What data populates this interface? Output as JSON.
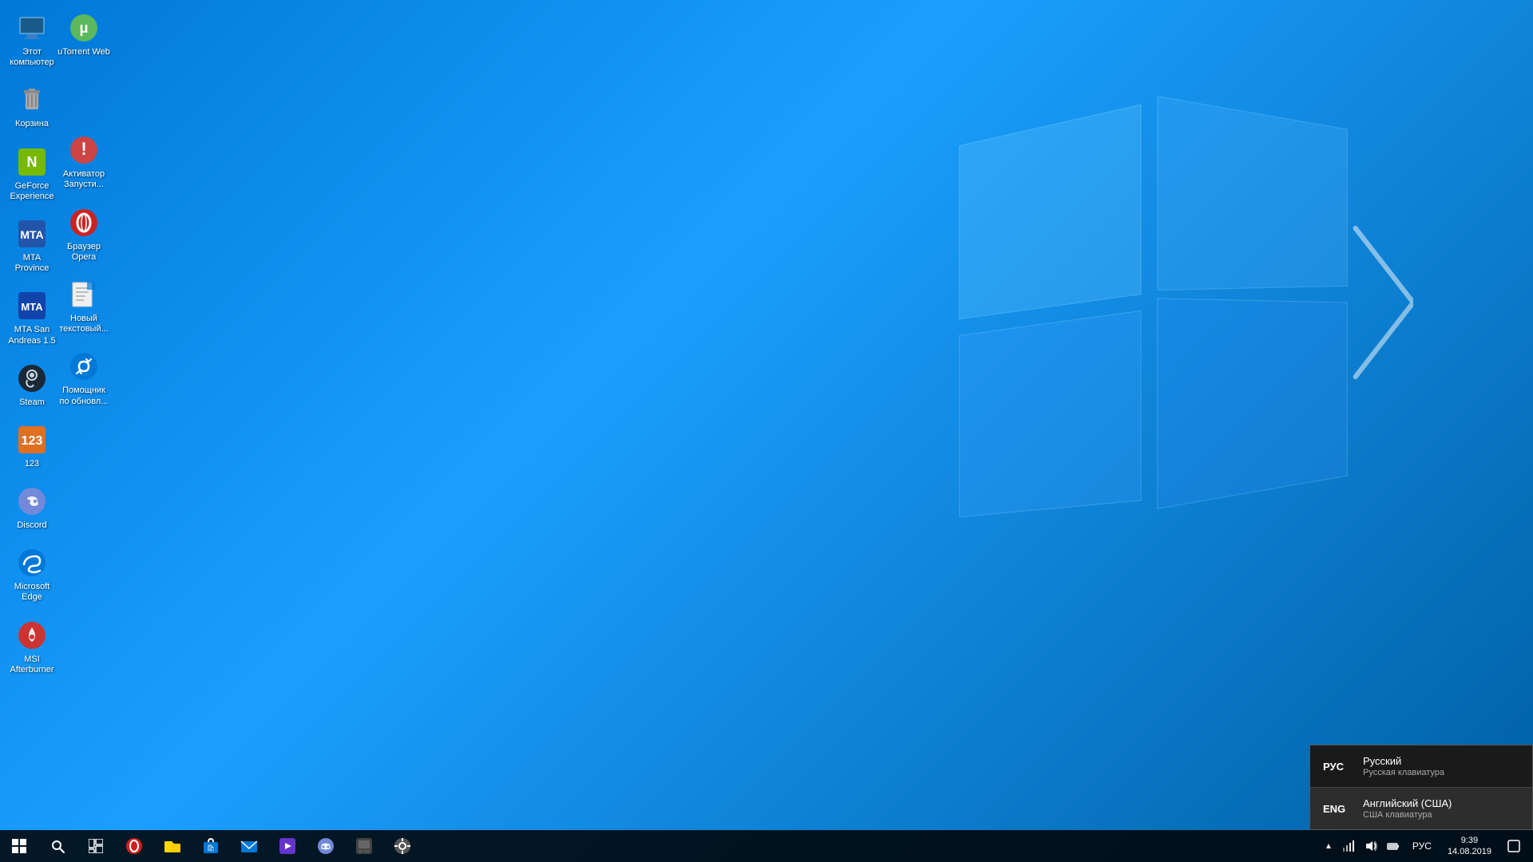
{
  "desktop": {
    "background_color_start": "#0078d7",
    "background_color_end": "#005fa3"
  },
  "icons_left": [
    {
      "id": "this-pc",
      "label": "Этот\nкомпьютер",
      "type": "pc"
    },
    {
      "id": "trash",
      "label": "Корзина",
      "type": "trash"
    },
    {
      "id": "geforce",
      "label": "GeForce\nExperience",
      "type": "geforce"
    },
    {
      "id": "mta-province",
      "label": "MTA\nProvince",
      "type": "mta"
    },
    {
      "id": "mta-san-andreas",
      "label": "MTA San\nAndreas 1.5",
      "type": "mtasa"
    },
    {
      "id": "steam",
      "label": "Steam",
      "type": "steam"
    },
    {
      "id": "123",
      "label": "123",
      "type": "123"
    },
    {
      "id": "discord",
      "label": "Discord",
      "type": "discord"
    },
    {
      "id": "microsoft-edge",
      "label": "Microsoft\nEdge",
      "type": "edge"
    },
    {
      "id": "msi-afterburner",
      "label": "MSI\nAfterburner",
      "type": "msi"
    }
  ],
  "icons_right": [
    {
      "id": "utorrent",
      "label": "uTorrent Web",
      "type": "utorrent"
    },
    {
      "id": "blank1",
      "label": "",
      "type": "blank"
    },
    {
      "id": "activator",
      "label": "Активатор\nЗапусти...",
      "type": "activator"
    },
    {
      "id": "opera",
      "label": "Браузер\nOpera",
      "type": "opera"
    },
    {
      "id": "notepad",
      "label": "Новый\nтекстовый...",
      "type": "notepad"
    },
    {
      "id": "updater",
      "label": "Помощник\nпо обновл...",
      "type": "updater"
    }
  ],
  "language_popup": {
    "items": [
      {
        "code": "РУС",
        "name": "Русский",
        "keyboard": "Русская клавиатура",
        "active": true
      },
      {
        "code": "ENG",
        "name": "Английский (США)",
        "keyboard": "США клавиатура",
        "active": false
      }
    ]
  },
  "taskbar": {
    "apps": [
      {
        "id": "opera-taskbar",
        "icon": "🔴"
      },
      {
        "id": "explorer",
        "icon": "📁"
      },
      {
        "id": "store",
        "icon": "🛍"
      },
      {
        "id": "mail",
        "icon": "✉"
      },
      {
        "id": "media",
        "icon": "▶"
      },
      {
        "id": "discord-taskbar",
        "icon": "🎮"
      },
      {
        "id": "app7",
        "icon": "📋"
      },
      {
        "id": "app8",
        "icon": "🔧"
      }
    ],
    "clock": {
      "time": "9:39",
      "date": "14.08.2019"
    },
    "lang": "РУС",
    "tray_icons": [
      "🔔",
      "🔊",
      "📶",
      "⚡"
    ]
  }
}
